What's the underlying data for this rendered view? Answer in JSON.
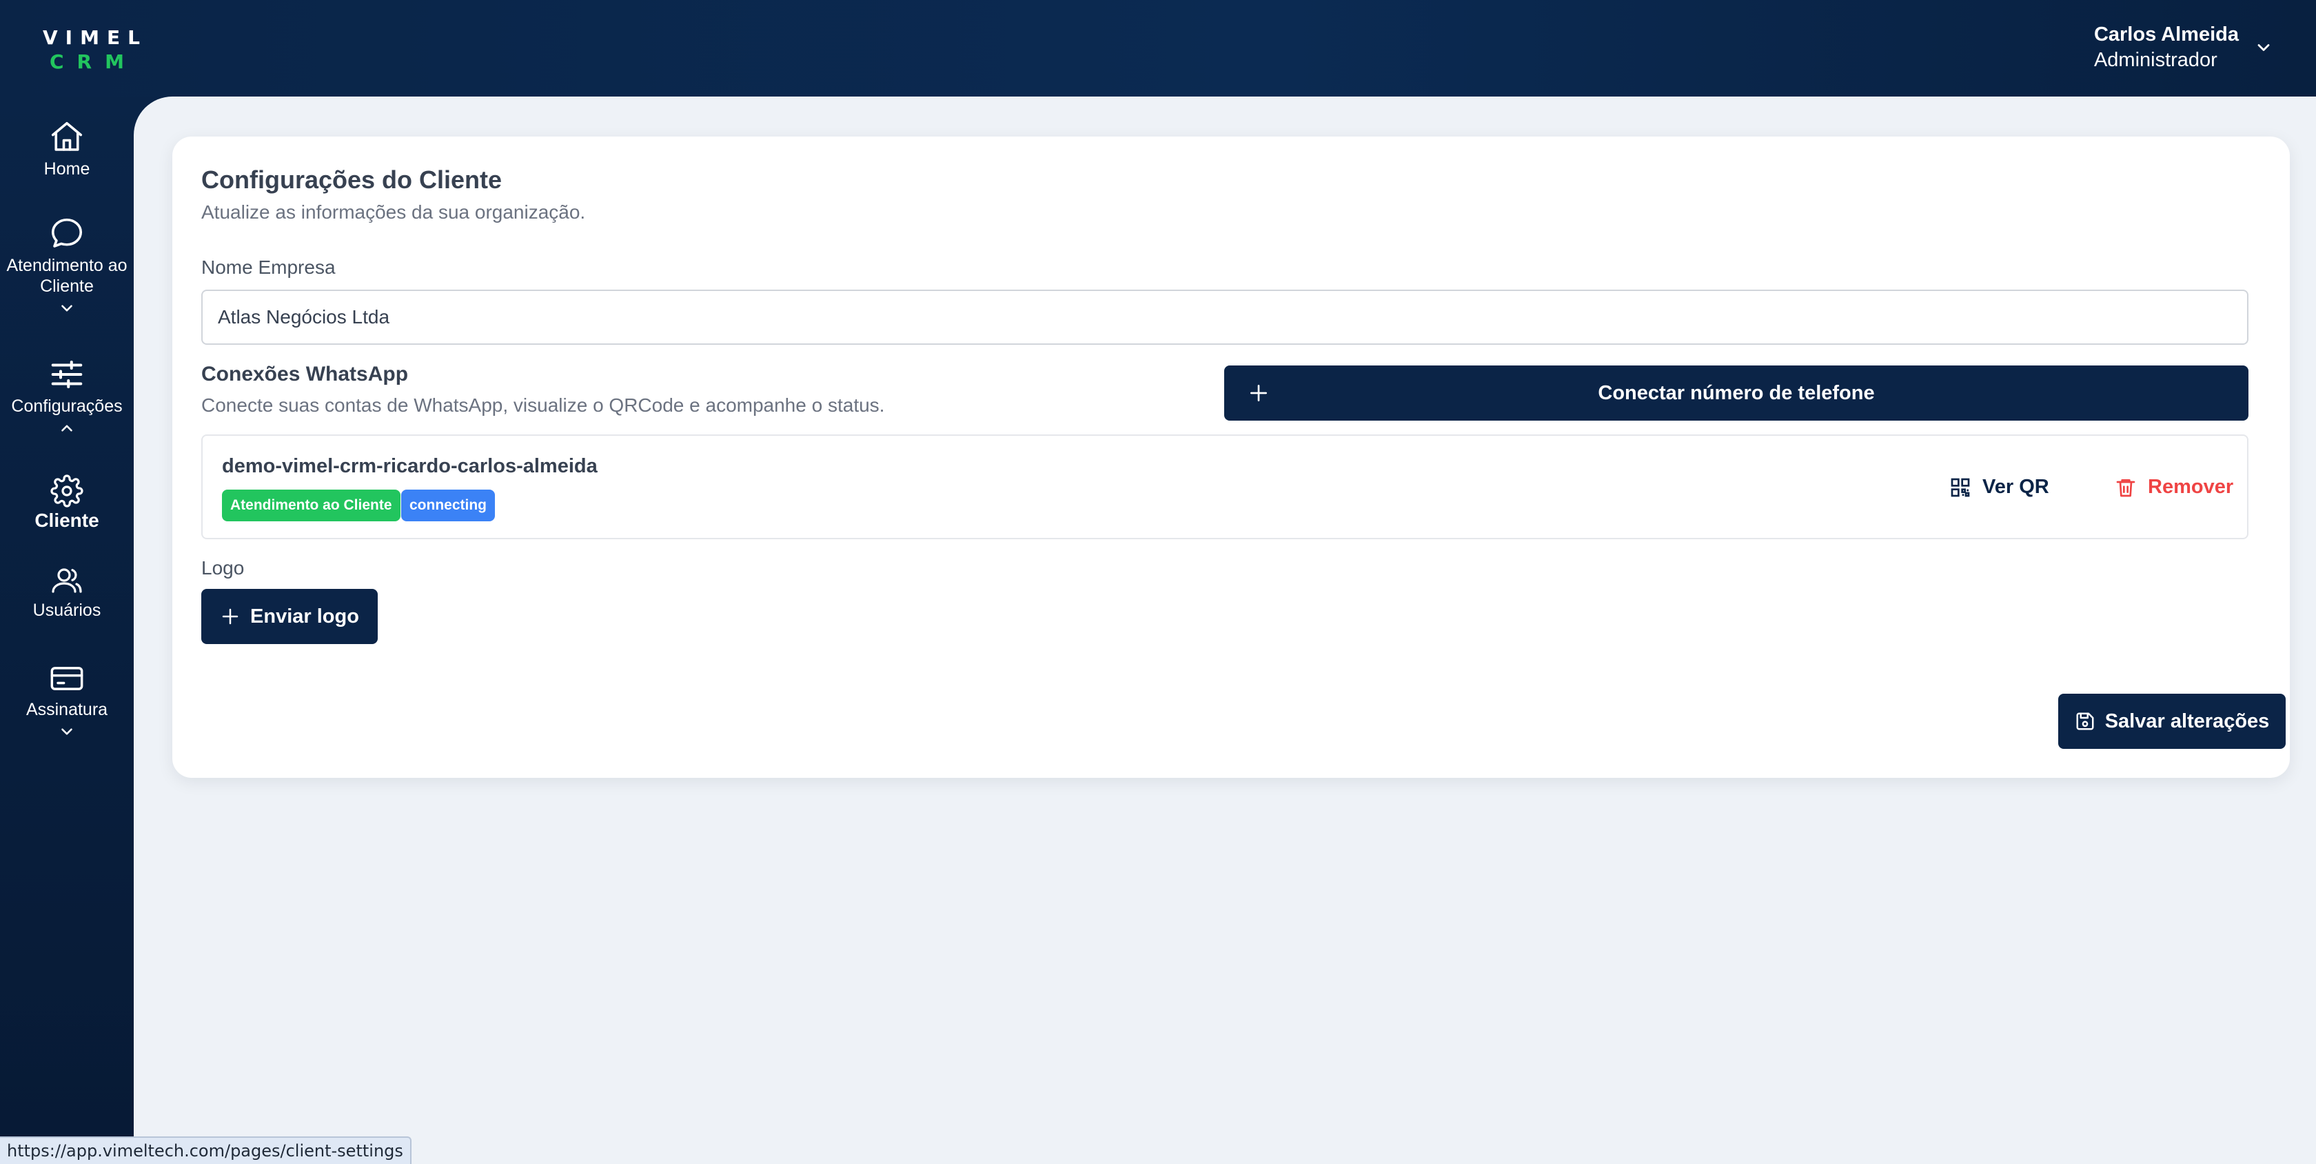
{
  "app": {
    "logo_line1": "VIMEL",
    "logo_line2": "CRM",
    "brand_colors": {
      "navy": "#0b2447",
      "green": "#22c55e",
      "blue": "#3b82f6",
      "red": "#ef4444"
    }
  },
  "user": {
    "name": "Carlos Almeida",
    "role": "Administrador",
    "menu_icon": "chevron-down-icon"
  },
  "sidebar": {
    "items": [
      {
        "label": "Home",
        "icon": "home-icon"
      },
      {
        "label": "Atendimento ao Cliente",
        "icon": "chat-icon",
        "chevron": "down"
      },
      {
        "label": "Configurações",
        "icon": "sliders-icon",
        "chevron": "up"
      },
      {
        "label": "Cliente",
        "icon": "gear-icon",
        "active": true
      },
      {
        "label": "Usuários",
        "icon": "users-icon"
      },
      {
        "label": "Assinatura",
        "icon": "credit-card-icon",
        "chevron": "down"
      }
    ]
  },
  "page": {
    "title": "Configurações do Cliente",
    "subtitle": "Atualize as informações da sua organização.",
    "company_label": "Nome Empresa",
    "company_value": "Atlas Negócios Ltda",
    "whatsapp": {
      "title": "Conexões WhatsApp",
      "subtitle": "Conecte suas contas de WhatsApp, visualize o QRCode e acompanhe o status.",
      "connect_button": "Conectar número de telefone",
      "connections": [
        {
          "name": "demo-vimel-crm-ricardo-carlos-almeida",
          "tag": "Atendimento ao Cliente",
          "status": "connecting",
          "qr_label": "Ver QR",
          "remove_label": "Remover"
        }
      ]
    },
    "logo_label": "Logo",
    "upload_button": "Enviar logo",
    "save_button": "Salvar alterações"
  },
  "statusbar": {
    "url": "https://app.vimeltech.com/pages/client-settings"
  }
}
